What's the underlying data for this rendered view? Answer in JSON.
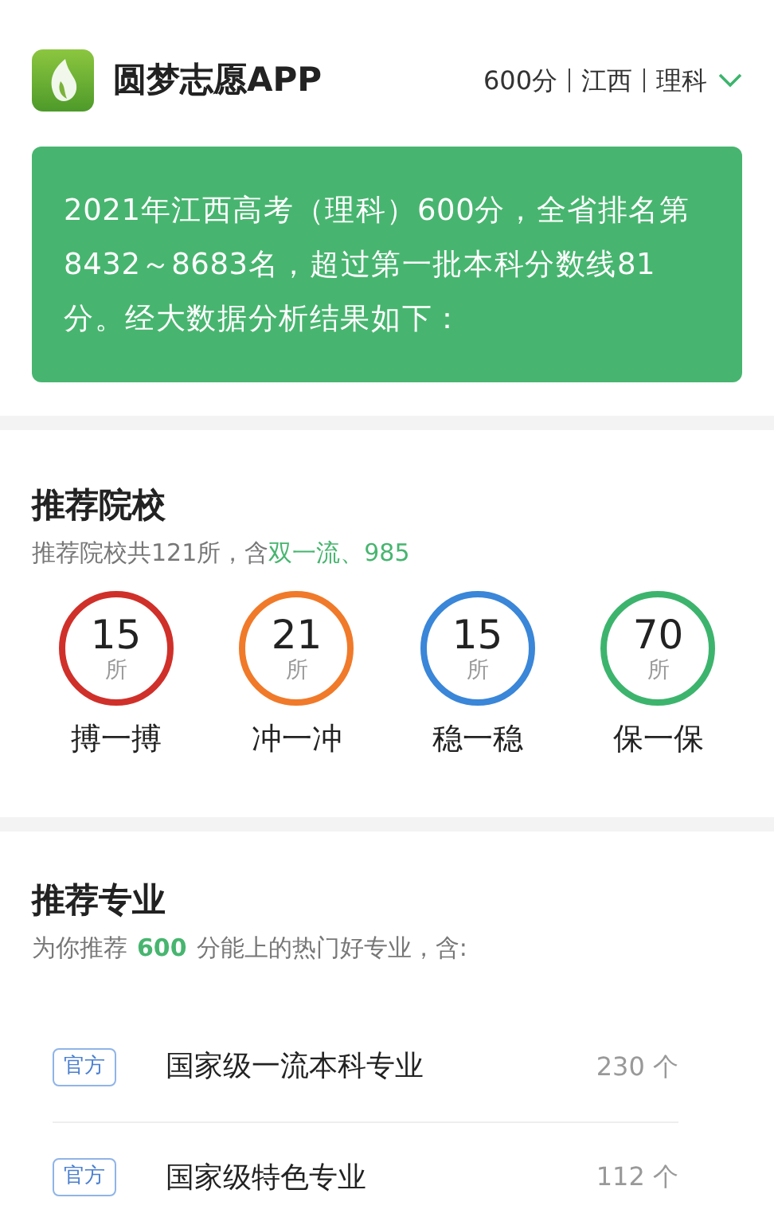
{
  "app": {
    "name": "圆梦志愿APP",
    "profile": {
      "score": "600分",
      "province": "江西",
      "track": "理科"
    }
  },
  "summary": "2021年江西高考（理科）600分，全省排名第8432～8683名，超过第一批本科分数线81分。经大数据分析结果如下：",
  "schools": {
    "title": "推荐院校",
    "subtitle": "推荐院校共121所，含",
    "highlight": "双一流、985",
    "tiers": [
      {
        "count": "15",
        "unit": "所",
        "label": "搏一搏",
        "color": "#d0302a"
      },
      {
        "count": "21",
        "unit": "所",
        "label": "冲一冲",
        "color": "#f07a2a"
      },
      {
        "count": "15",
        "unit": "所",
        "label": "稳一稳",
        "color": "#3a86d8"
      },
      {
        "count": "70",
        "unit": "所",
        "label": "保一保",
        "color": "#3db46d"
      }
    ]
  },
  "majors": {
    "title": "推荐专业",
    "subtitle_before": "为你推荐",
    "score": "600",
    "subtitle_after": "分能上的热门好专业，含:",
    "rows": [
      {
        "tag": "官方",
        "name": "国家级一流本科专业",
        "count": "230 个"
      },
      {
        "tag": "官方",
        "name": "国家级特色专业",
        "count": "112 个"
      }
    ]
  }
}
